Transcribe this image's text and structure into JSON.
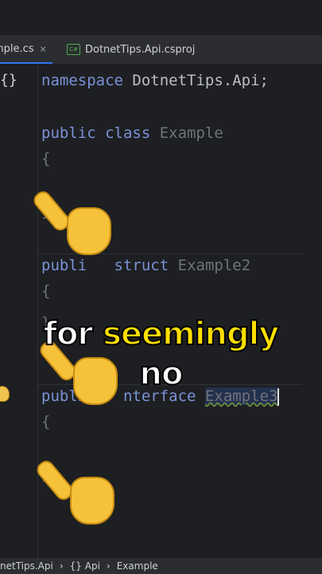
{
  "tabs": [
    {
      "label": "mple.cs",
      "close": "×",
      "active": true
    },
    {
      "label": "DotnetTips.Api.csproj",
      "icon": "C#",
      "active": false
    }
  ],
  "editor": {
    "fold_icon": "{}",
    "lines": {
      "namespace_kw": "namespace",
      "namespace_name": "DotnetTips.Api;",
      "class_kw": "public class",
      "class_name": "Example",
      "brace_open": "{",
      "brace_close": "}",
      "struct_kw": "publi",
      "struct_kw2": "struct",
      "struct_name": "Example2",
      "interface_kw": "publi",
      "interface_kw2": "nterface",
      "interface_name": "Example3"
    }
  },
  "caption": {
    "word1": "for",
    "word2": "seemingly",
    "word3": "no"
  },
  "statusbar": {
    "item1": "netTips.Api",
    "item2": "{} Api",
    "item3": "Example"
  },
  "colors": {
    "keyword": "#7a93d8",
    "caption_highlight": "#ffe000",
    "background": "#1e1f22"
  }
}
